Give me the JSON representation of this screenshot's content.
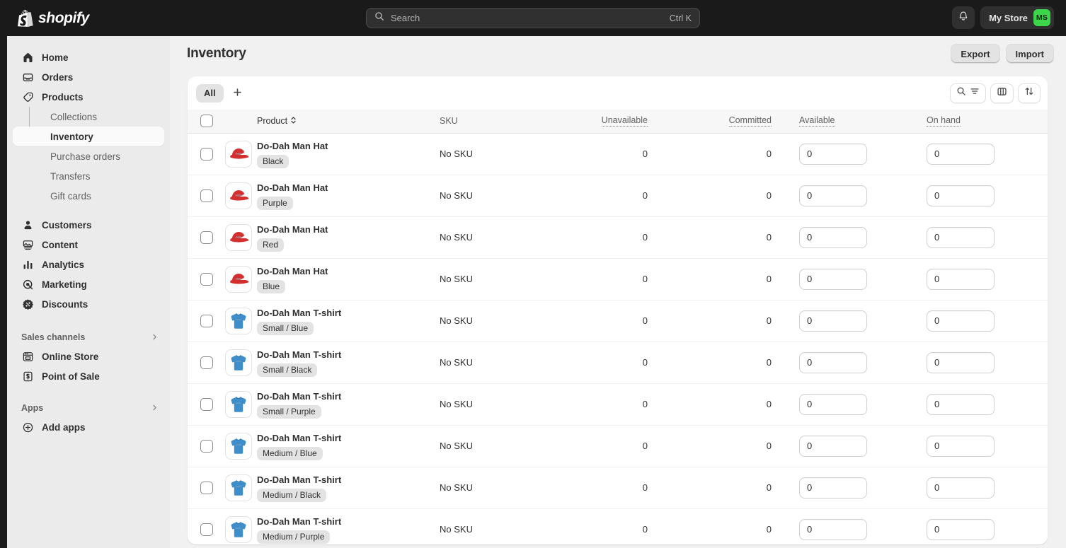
{
  "brand": {
    "name": "shopify",
    "logo_icon": "shopify-bag-icon"
  },
  "topbar": {
    "search": {
      "placeholder": "Search",
      "shortcut": "Ctrl K",
      "icon": "search-icon"
    },
    "notifications_icon": "bell-icon",
    "store_name": "My Store",
    "avatar_initials": "MS",
    "avatar_color": "#3bd64a"
  },
  "sidebar": {
    "items": [
      {
        "label": "Home",
        "icon": "home-icon"
      },
      {
        "label": "Orders",
        "icon": "orders-inbox-icon"
      },
      {
        "label": "Products",
        "icon": "products-tag-icon"
      }
    ],
    "product_subitems": [
      {
        "label": "Collections",
        "active": false
      },
      {
        "label": "Inventory",
        "active": true
      },
      {
        "label": "Purchase orders",
        "active": false
      },
      {
        "label": "Transfers",
        "active": false
      },
      {
        "label": "Gift cards",
        "active": false
      }
    ],
    "items2": [
      {
        "label": "Customers",
        "icon": "customer-person-icon"
      },
      {
        "label": "Content",
        "icon": "content-image-icon"
      },
      {
        "label": "Analytics",
        "icon": "analytics-bars-icon"
      },
      {
        "label": "Marketing",
        "icon": "marketing-target-icon"
      },
      {
        "label": "Discounts",
        "icon": "discount-gear-icon"
      }
    ],
    "sales_channels": {
      "heading": "Sales channels",
      "chevron_icon": "chevron-right-icon",
      "items": [
        {
          "label": "Online Store",
          "icon": "storefront-icon"
        },
        {
          "label": "Point of Sale",
          "icon": "pos-receipt-icon"
        }
      ]
    },
    "apps": {
      "heading": "Apps",
      "chevron_icon": "chevron-right-icon",
      "items": [
        {
          "label": "Add apps",
          "icon": "plus-circle-icon"
        }
      ]
    }
  },
  "page": {
    "title": "Inventory",
    "actions": [
      {
        "label": "Export",
        "name": "export-button"
      },
      {
        "label": "Import",
        "name": "import-button"
      }
    ]
  },
  "card": {
    "tabs": [
      {
        "label": "All",
        "active": true
      }
    ],
    "add_tab_icon": "plus-icon",
    "toolbar_buttons": [
      {
        "name": "search-and-filter-button",
        "icons": "search-icon + filter-icon"
      },
      {
        "name": "edit-columns-button",
        "icon": "columns-icon"
      },
      {
        "name": "sort-button",
        "icon": "sort-arrows-icon"
      }
    ]
  },
  "table": {
    "select_all_checkbox": false,
    "columns": [
      {
        "key": "product",
        "label": "Product",
        "sortable": true,
        "sort_icon": "sort-chevrons-icon",
        "dotted": false
      },
      {
        "key": "sku",
        "label": "SKU",
        "dotted": false
      },
      {
        "key": "unavailable",
        "label": "Unavailable",
        "dotted": true
      },
      {
        "key": "committed",
        "label": "Committed",
        "dotted": true
      },
      {
        "key": "available",
        "label": "Available",
        "dotted": true
      },
      {
        "key": "on_hand",
        "label": "On hand",
        "dotted": true
      }
    ],
    "rows": [
      {
        "thumb": "hat",
        "product": "Do-Dah Man Hat",
        "variant": "Black",
        "sku": "No SKU",
        "unavailable": "0",
        "committed": "0",
        "available": "0",
        "on_hand": "0"
      },
      {
        "thumb": "hat",
        "product": "Do-Dah Man Hat",
        "variant": "Purple",
        "sku": "No SKU",
        "unavailable": "0",
        "committed": "0",
        "available": "0",
        "on_hand": "0"
      },
      {
        "thumb": "hat",
        "product": "Do-Dah Man Hat",
        "variant": "Red",
        "sku": "No SKU",
        "unavailable": "0",
        "committed": "0",
        "available": "0",
        "on_hand": "0"
      },
      {
        "thumb": "hat",
        "product": "Do-Dah Man Hat",
        "variant": "Blue",
        "sku": "No SKU",
        "unavailable": "0",
        "committed": "0",
        "available": "0",
        "on_hand": "0"
      },
      {
        "thumb": "tshirt",
        "product": "Do-Dah Man T-shirt",
        "variant": "Small / Blue",
        "sku": "No SKU",
        "unavailable": "0",
        "committed": "0",
        "available": "0",
        "on_hand": "0"
      },
      {
        "thumb": "tshirt",
        "product": "Do-Dah Man T-shirt",
        "variant": "Small / Black",
        "sku": "No SKU",
        "unavailable": "0",
        "committed": "0",
        "available": "0",
        "on_hand": "0"
      },
      {
        "thumb": "tshirt",
        "product": "Do-Dah Man T-shirt",
        "variant": "Small / Purple",
        "sku": "No SKU",
        "unavailable": "0",
        "committed": "0",
        "available": "0",
        "on_hand": "0"
      },
      {
        "thumb": "tshirt",
        "product": "Do-Dah Man T-shirt",
        "variant": "Medium / Blue",
        "sku": "No SKU",
        "unavailable": "0",
        "committed": "0",
        "available": "0",
        "on_hand": "0"
      },
      {
        "thumb": "tshirt",
        "product": "Do-Dah Man T-shirt",
        "variant": "Medium / Black",
        "sku": "No SKU",
        "unavailable": "0",
        "committed": "0",
        "available": "0",
        "on_hand": "0"
      },
      {
        "thumb": "tshirt",
        "product": "Do-Dah Man T-shirt",
        "variant": "Medium / Purple",
        "sku": "No SKU",
        "unavailable": "0",
        "committed": "0",
        "available": "0",
        "on_hand": "0"
      }
    ]
  },
  "colors": {
    "topbar_bg": "#1a1a1a",
    "sidebar_bg": "#ebebeb",
    "main_bg": "#f1f1f1",
    "card_bg": "#ffffff",
    "accent_green": "#3bd64a",
    "text_primary": "#303030",
    "text_secondary": "#616161"
  }
}
